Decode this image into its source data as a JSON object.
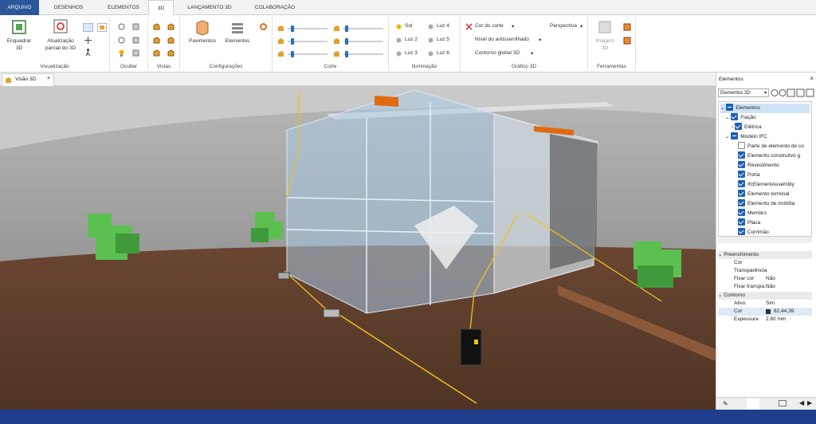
{
  "tabs": [
    "ARQUIVO",
    "DESENHOS",
    "ELEMENTOS",
    "3D",
    "LANÇAMENTO 3D",
    "COLABORAÇÃO"
  ],
  "ribbon": {
    "visualizacao": {
      "label": "Visualização",
      "enquadrar": "Enquadrar",
      "enquadrar2": "3D",
      "atualizacao": "Atualização",
      "atualizacao2": "parcial do 3D"
    },
    "ocultar": {
      "label": "Ocultar"
    },
    "vistas": {
      "label": "Vistas"
    },
    "configuracoes": {
      "label": "Configurações",
      "pavimentos": "Pavimentos",
      "elementos": "Elementos"
    },
    "corte": {
      "label": "Corte"
    },
    "iluminacao": {
      "label": "Iluminação",
      "sol": "Sol",
      "luz2": "Luz 2",
      "luz3": "Luz 3",
      "luz4": "Luz 4",
      "luz5": "Luz 5",
      "luz6": "Luz 6"
    },
    "grafico": {
      "label": "Gráfico 3D",
      "cor_corte": "Cor do corte",
      "antisserrilhado": "Nível do antisserrilhado",
      "contorno": "Contorno global 3D",
      "perspectiva": "Perspectiva"
    },
    "ferramentas": {
      "label": "Ferramentas",
      "imagem": "Imagem",
      "imagem2": "3D"
    }
  },
  "doc_tab": "Visão 3D",
  "panel": {
    "title": "Elementos",
    "dropdown": "Elementos 3D",
    "tree": [
      "Elementos",
      "Fiação",
      "Elétrica",
      "Modelo IFC",
      "Parte de elemento de co",
      "Elemento construtivo g",
      "Revestimento",
      "Porta",
      "IfcElementAssembly",
      "Elemento terminal",
      "Elemento de mobília",
      "Membro",
      "Placa",
      "Corrimão"
    ],
    "sec1": "Preenchimento",
    "cor": "Cor",
    "transparencia": "Transparência",
    "fixar_cor": "Fixar cor",
    "fixar_cor_val": "Não",
    "fixar_transp": "Fixar transpa...",
    "fixar_transp_val": "Não",
    "sec2": "Contorno",
    "ativo": "Ativo",
    "ativo_val": "Sim",
    "cor2": "Cor",
    "cor2_val": "62,44,39",
    "espessura": "Espessura",
    "espessura_val": "2.80 mm"
  },
  "colors": {
    "accent": "#2b579a",
    "status": "#1f3f8c",
    "floor": "#5e4030",
    "glass": "#b8d4ec",
    "foliage": "#4cb848"
  }
}
